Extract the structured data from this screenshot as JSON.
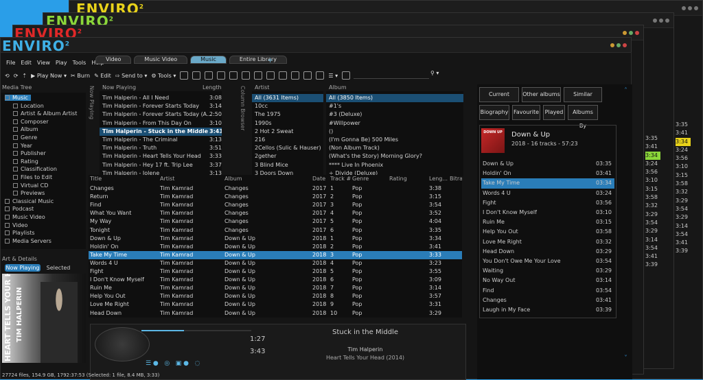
{
  "app": {
    "logo_text": "ENVIRO",
    "logo_sup": "2"
  },
  "menu": [
    "File",
    "Edit",
    "View",
    "Play",
    "Tools",
    "Help"
  ],
  "tabs": [
    "Video",
    "Music Video",
    "Music",
    "Entire Library"
  ],
  "toolbar": {
    "play_now": "Play Now",
    "burn": "Burn",
    "edit": "Edit",
    "send_to": "Send to",
    "tools": "Tools"
  },
  "media_tree": {
    "header": "Media Tree",
    "items": [
      {
        "label": "Music",
        "level": 0,
        "selected": true
      },
      {
        "label": "Location",
        "level": 1
      },
      {
        "label": "Artist & Album Artist",
        "level": 1
      },
      {
        "label": "Composer",
        "level": 1
      },
      {
        "label": "Album",
        "level": 1
      },
      {
        "label": "Genre",
        "level": 1
      },
      {
        "label": "Year",
        "level": 1
      },
      {
        "label": "Publisher",
        "level": 1
      },
      {
        "label": "Rating",
        "level": 1
      },
      {
        "label": "Classification",
        "level": 1
      },
      {
        "label": "Files to Edit",
        "level": 1
      },
      {
        "label": "Virtual CD",
        "level": 1
      },
      {
        "label": "Previews",
        "level": 1
      },
      {
        "label": "Classical Music",
        "level": 0
      },
      {
        "label": "Podcast",
        "level": 0
      },
      {
        "label": "Music Video",
        "level": 0
      },
      {
        "label": "Video",
        "level": 0
      },
      {
        "label": "Playlists",
        "level": 0
      },
      {
        "label": "Media Servers",
        "level": 0
      }
    ]
  },
  "art": {
    "header": "Art & Details",
    "tab_now_playing": "Now Playing",
    "tab_selected": "Selected",
    "cover_text_1": "HEART TELLS YOUR HEAD",
    "cover_text_2": "TIM HALPERIN"
  },
  "now_playing": {
    "vtab": "Now Playing",
    "col_title": "Now Playing",
    "col_length": "Length",
    "rows": [
      {
        "title": "Tim Halperin - All I Need",
        "length": "3:08"
      },
      {
        "title": "Tim Halperin - Forever Starts Today",
        "length": "3:14"
      },
      {
        "title": "Tim Halperin - Forever Starts Today (A...",
        "length": "2:50"
      },
      {
        "title": "Tim Halperin - From This Day On",
        "length": "3:10"
      },
      {
        "title": "Tim Halperin - Stuck in the Middle",
        "length": "3:43",
        "selected": true
      },
      {
        "title": "Tim Halperin - The Criminal",
        "length": "3:13"
      },
      {
        "title": "Tim Halperin - Truth",
        "length": "3:51"
      },
      {
        "title": "Tim Halperin - Heart Tells Your Head",
        "length": "3:33"
      },
      {
        "title": "Tim Halperin - Hey 17 ft. Trip Lee",
        "length": "3:37"
      },
      {
        "title": "Tim Halperin - Jolene",
        "length": "3:13"
      }
    ]
  },
  "column_browser": {
    "vtab": "Column Browser",
    "artist_header": "Artist",
    "artists": [
      "All (3631 Items)",
      "10cc",
      "The 1975",
      "1990s",
      "2 Hot 2 Sweat",
      "216",
      "2Cellos (Sulic & Hauser)",
      "2gether",
      "3 Blind Mice",
      "3 Doors Down"
    ],
    "album_header": "Album",
    "albums": [
      "All (3850 Items)",
      "#1's",
      "#3 (Deluxe)",
      "#Willpower",
      "()",
      "(I'm Gonna Be) 500 Miles",
      "(Non Album Track)",
      "(What's the Story) Morning Glory?",
      "**** Live In Phoenix",
      "÷ Divide (Deluxe)"
    ]
  },
  "tracklist": {
    "headers": [
      "Title",
      "Artist",
      "Album",
      "Date",
      "Track #",
      "Genre",
      "Rating",
      "Leng...",
      "Bitra..."
    ],
    "rows": [
      [
        "Changes",
        "Tim Kamrad",
        "Changes",
        "2017",
        "1",
        "Pop",
        "3:38"
      ],
      [
        "Return",
        "Tim Kamrad",
        "Changes",
        "2017",
        "2",
        "Pop",
        "3:15"
      ],
      [
        "Find",
        "Tim Kamrad",
        "Changes",
        "2017",
        "3",
        "Pop",
        "3:54"
      ],
      [
        "What You Want",
        "Tim Kamrad",
        "Changes",
        "2017",
        "4",
        "Pop",
        "3:52"
      ],
      [
        "My Way",
        "Tim Kamrad",
        "Changes",
        "2017",
        "5",
        "Pop",
        "4:04"
      ],
      [
        "Tonight",
        "Tim Kamrad",
        "Changes",
        "2017",
        "6",
        "Pop",
        "3:35"
      ],
      [
        "Down & Up",
        "Tim Kamrad",
        "Down & Up",
        "2018",
        "1",
        "Pop",
        "3:34"
      ],
      [
        "Holdin' On",
        "Tim Kamrad",
        "Down & Up",
        "2018",
        "2",
        "Pop",
        "3:41"
      ],
      [
        "Take My Time",
        "Tim Kamrad",
        "Down & Up",
        "2018",
        "3",
        "Pop",
        "3:33"
      ],
      [
        "Words 4 U",
        "Tim Kamrad",
        "Down & Up",
        "2018",
        "4",
        "Pop",
        "3:23"
      ],
      [
        "Fight",
        "Tim Kamrad",
        "Down & Up",
        "2018",
        "5",
        "Pop",
        "3:55"
      ],
      [
        "I Don't Know Myself",
        "Tim Kamrad",
        "Down & Up",
        "2018",
        "6",
        "Pop",
        "3:09"
      ],
      [
        "Ruin Me",
        "Tim Kamrad",
        "Down & Up",
        "2018",
        "7",
        "Pop",
        "3:14"
      ],
      [
        "Help You Out",
        "Tim Kamrad",
        "Down & Up",
        "2018",
        "8",
        "Pop",
        "3:57"
      ],
      [
        "Love Me Right",
        "Tim Kamrad",
        "Down & Up",
        "2018",
        "9",
        "Pop",
        "3:31"
      ],
      [
        "Head Down",
        "Tim Kamrad",
        "Down & Up",
        "2018",
        "10",
        "Pop",
        "3:29"
      ]
    ],
    "selected_index": 8
  },
  "player": {
    "elapsed": "1:27",
    "total": "3:43",
    "title": "Stuck in the Middle",
    "artist": "Tim Halperin",
    "album": "Heart Tells Your Head (2014)",
    "progress": 0.39
  },
  "right_panel": {
    "buttons_row1": [
      "Current Album",
      "Other albums",
      "Similar artists"
    ],
    "buttons_row2": [
      "Biography",
      "Favourite",
      "Played",
      "Albums By"
    ],
    "album_title": "Down & Up",
    "album_meta": "2018 - 16 tracks - 57:23",
    "cover_text": "DOWN UP",
    "tracks": [
      [
        "Down & Up",
        "03:35"
      ],
      [
        "Holdin' On",
        "03:41"
      ],
      [
        "Take My Time",
        "03:34"
      ],
      [
        "Words 4 U",
        "03:24"
      ],
      [
        "Fight",
        "03:56"
      ],
      [
        "I Don't Know Myself",
        "03:10"
      ],
      [
        "Ruin Me",
        "03:15"
      ],
      [
        "Help You Out",
        "03:58"
      ],
      [
        "Love Me Right",
        "03:32"
      ],
      [
        "Head Down",
        "03:29"
      ],
      [
        "You Don't Owe Me Your Love",
        "03:54"
      ],
      [
        "Waiting",
        "03:29"
      ],
      [
        "No Way Out",
        "03:14"
      ],
      [
        "Find",
        "03:54"
      ],
      [
        "Changes",
        "03:41"
      ],
      [
        "Laugh in My Face",
        "03:39"
      ]
    ],
    "selected_index": 2
  },
  "bg_windows": {
    "col_a": [
      "3:35",
      "3:41",
      "3:34",
      "3:24",
      "3:56",
      "3:10",
      "3:15",
      "3:58",
      "3:32",
      "3:29",
      "3:54",
      "3:29",
      "3:14",
      "3:54",
      "3:41",
      "3:39"
    ],
    "col_b": [
      "3:35",
      "3:41",
      "3:34",
      "3:24",
      "3:56",
      "3:10",
      "3:15",
      "3:58",
      "3:32",
      "3:29",
      "3:54",
      "3:29",
      "3:14",
      "3:54",
      "3:41",
      "3:39"
    ]
  },
  "status": "27724 files, 154.9 GB, 1792:37:53 (Selected: 1 file, 8.4 MB, 3:33)",
  "colors": {
    "accent": "#2a7db8",
    "sel_row": "#1b6fa8",
    "bg": "#151515"
  }
}
